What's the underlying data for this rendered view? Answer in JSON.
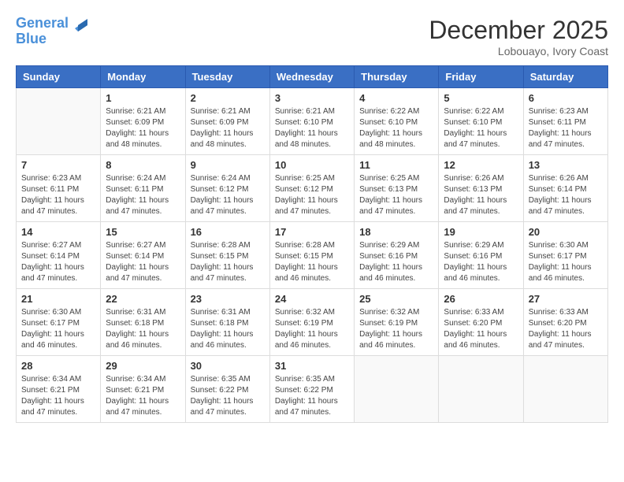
{
  "header": {
    "logo_line1": "General",
    "logo_line2": "Blue",
    "month": "December 2025",
    "location": "Lobouayo, Ivory Coast"
  },
  "days_of_week": [
    "Sunday",
    "Monday",
    "Tuesday",
    "Wednesday",
    "Thursday",
    "Friday",
    "Saturday"
  ],
  "weeks": [
    [
      {
        "day": "",
        "sunrise": "",
        "sunset": "",
        "daylight": ""
      },
      {
        "day": "1",
        "sunrise": "Sunrise: 6:21 AM",
        "sunset": "Sunset: 6:09 PM",
        "daylight": "Daylight: 11 hours and 48 minutes."
      },
      {
        "day": "2",
        "sunrise": "Sunrise: 6:21 AM",
        "sunset": "Sunset: 6:09 PM",
        "daylight": "Daylight: 11 hours and 48 minutes."
      },
      {
        "day": "3",
        "sunrise": "Sunrise: 6:21 AM",
        "sunset": "Sunset: 6:10 PM",
        "daylight": "Daylight: 11 hours and 48 minutes."
      },
      {
        "day": "4",
        "sunrise": "Sunrise: 6:22 AM",
        "sunset": "Sunset: 6:10 PM",
        "daylight": "Daylight: 11 hours and 48 minutes."
      },
      {
        "day": "5",
        "sunrise": "Sunrise: 6:22 AM",
        "sunset": "Sunset: 6:10 PM",
        "daylight": "Daylight: 11 hours and 47 minutes."
      },
      {
        "day": "6",
        "sunrise": "Sunrise: 6:23 AM",
        "sunset": "Sunset: 6:11 PM",
        "daylight": "Daylight: 11 hours and 47 minutes."
      }
    ],
    [
      {
        "day": "7",
        "sunrise": "Sunrise: 6:23 AM",
        "sunset": "Sunset: 6:11 PM",
        "daylight": "Daylight: 11 hours and 47 minutes."
      },
      {
        "day": "8",
        "sunrise": "Sunrise: 6:24 AM",
        "sunset": "Sunset: 6:11 PM",
        "daylight": "Daylight: 11 hours and 47 minutes."
      },
      {
        "day": "9",
        "sunrise": "Sunrise: 6:24 AM",
        "sunset": "Sunset: 6:12 PM",
        "daylight": "Daylight: 11 hours and 47 minutes."
      },
      {
        "day": "10",
        "sunrise": "Sunrise: 6:25 AM",
        "sunset": "Sunset: 6:12 PM",
        "daylight": "Daylight: 11 hours and 47 minutes."
      },
      {
        "day": "11",
        "sunrise": "Sunrise: 6:25 AM",
        "sunset": "Sunset: 6:13 PM",
        "daylight": "Daylight: 11 hours and 47 minutes."
      },
      {
        "day": "12",
        "sunrise": "Sunrise: 6:26 AM",
        "sunset": "Sunset: 6:13 PM",
        "daylight": "Daylight: 11 hours and 47 minutes."
      },
      {
        "day": "13",
        "sunrise": "Sunrise: 6:26 AM",
        "sunset": "Sunset: 6:14 PM",
        "daylight": "Daylight: 11 hours and 47 minutes."
      }
    ],
    [
      {
        "day": "14",
        "sunrise": "Sunrise: 6:27 AM",
        "sunset": "Sunset: 6:14 PM",
        "daylight": "Daylight: 11 hours and 47 minutes."
      },
      {
        "day": "15",
        "sunrise": "Sunrise: 6:27 AM",
        "sunset": "Sunset: 6:14 PM",
        "daylight": "Daylight: 11 hours and 47 minutes."
      },
      {
        "day": "16",
        "sunrise": "Sunrise: 6:28 AM",
        "sunset": "Sunset: 6:15 PM",
        "daylight": "Daylight: 11 hours and 47 minutes."
      },
      {
        "day": "17",
        "sunrise": "Sunrise: 6:28 AM",
        "sunset": "Sunset: 6:15 PM",
        "daylight": "Daylight: 11 hours and 46 minutes."
      },
      {
        "day": "18",
        "sunrise": "Sunrise: 6:29 AM",
        "sunset": "Sunset: 6:16 PM",
        "daylight": "Daylight: 11 hours and 46 minutes."
      },
      {
        "day": "19",
        "sunrise": "Sunrise: 6:29 AM",
        "sunset": "Sunset: 6:16 PM",
        "daylight": "Daylight: 11 hours and 46 minutes."
      },
      {
        "day": "20",
        "sunrise": "Sunrise: 6:30 AM",
        "sunset": "Sunset: 6:17 PM",
        "daylight": "Daylight: 11 hours and 46 minutes."
      }
    ],
    [
      {
        "day": "21",
        "sunrise": "Sunrise: 6:30 AM",
        "sunset": "Sunset: 6:17 PM",
        "daylight": "Daylight: 11 hours and 46 minutes."
      },
      {
        "day": "22",
        "sunrise": "Sunrise: 6:31 AM",
        "sunset": "Sunset: 6:18 PM",
        "daylight": "Daylight: 11 hours and 46 minutes."
      },
      {
        "day": "23",
        "sunrise": "Sunrise: 6:31 AM",
        "sunset": "Sunset: 6:18 PM",
        "daylight": "Daylight: 11 hours and 46 minutes."
      },
      {
        "day": "24",
        "sunrise": "Sunrise: 6:32 AM",
        "sunset": "Sunset: 6:19 PM",
        "daylight": "Daylight: 11 hours and 46 minutes."
      },
      {
        "day": "25",
        "sunrise": "Sunrise: 6:32 AM",
        "sunset": "Sunset: 6:19 PM",
        "daylight": "Daylight: 11 hours and 46 minutes."
      },
      {
        "day": "26",
        "sunrise": "Sunrise: 6:33 AM",
        "sunset": "Sunset: 6:20 PM",
        "daylight": "Daylight: 11 hours and 46 minutes."
      },
      {
        "day": "27",
        "sunrise": "Sunrise: 6:33 AM",
        "sunset": "Sunset: 6:20 PM",
        "daylight": "Daylight: 11 hours and 47 minutes."
      }
    ],
    [
      {
        "day": "28",
        "sunrise": "Sunrise: 6:34 AM",
        "sunset": "Sunset: 6:21 PM",
        "daylight": "Daylight: 11 hours and 47 minutes."
      },
      {
        "day": "29",
        "sunrise": "Sunrise: 6:34 AM",
        "sunset": "Sunset: 6:21 PM",
        "daylight": "Daylight: 11 hours and 47 minutes."
      },
      {
        "day": "30",
        "sunrise": "Sunrise: 6:35 AM",
        "sunset": "Sunset: 6:22 PM",
        "daylight": "Daylight: 11 hours and 47 minutes."
      },
      {
        "day": "31",
        "sunrise": "Sunrise: 6:35 AM",
        "sunset": "Sunset: 6:22 PM",
        "daylight": "Daylight: 11 hours and 47 minutes."
      },
      {
        "day": "",
        "sunrise": "",
        "sunset": "",
        "daylight": ""
      },
      {
        "day": "",
        "sunrise": "",
        "sunset": "",
        "daylight": ""
      },
      {
        "day": "",
        "sunrise": "",
        "sunset": "",
        "daylight": ""
      }
    ]
  ]
}
